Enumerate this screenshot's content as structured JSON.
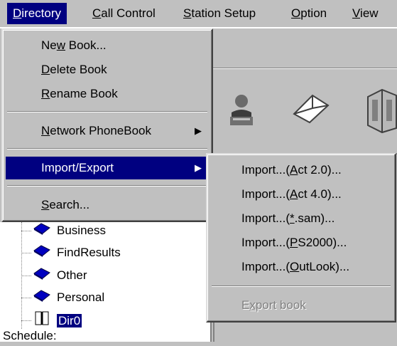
{
  "menubar": {
    "items": [
      {
        "label_pre": "",
        "label_u": "D",
        "label_post": "irectory"
      },
      {
        "label_pre": "",
        "label_u": "C",
        "label_post": "all Control"
      },
      {
        "label_pre": "",
        "label_u": "S",
        "label_post": "tation Setup"
      },
      {
        "label_pre": "",
        "label_u": "O",
        "label_post": "ption"
      },
      {
        "label_pre": "",
        "label_u": "V",
        "label_post": "iew"
      }
    ]
  },
  "directory_menu": {
    "items": [
      {
        "pre": "Ne",
        "u": "w",
        "post": " Book..."
      },
      {
        "pre": "",
        "u": "D",
        "post": "elete Book"
      },
      {
        "pre": "",
        "u": "R",
        "post": "ename Book"
      },
      {
        "pre": "",
        "u": "N",
        "post": "etwork PhoneBook"
      },
      {
        "pre": "Import/Export",
        "u": "",
        "post": ""
      },
      {
        "pre": "",
        "u": "S",
        "post": "earch..."
      }
    ]
  },
  "import_submenu": {
    "items": [
      {
        "pre": "Import...(",
        "u": "A",
        "post": "ct 2.0)..."
      },
      {
        "pre": "Import...(",
        "u": "A",
        "post": "ct 4.0)..."
      },
      {
        "pre": "Import...(",
        "u": "*",
        "post": ".sam)..."
      },
      {
        "pre": "Import...(",
        "u": "P",
        "post": "S2000)..."
      },
      {
        "pre": "Import...(",
        "u": "O",
        "post": "utLook)..."
      },
      {
        "pre": "E",
        "u": "x",
        "post": "port book"
      }
    ]
  },
  "tree": {
    "items": [
      "Business",
      "FindResults",
      "Other",
      "Personal",
      "Dir0"
    ],
    "footer": "Schedule:"
  },
  "colors": {
    "face": "#c0c0c0",
    "highlight": "#000080",
    "book_blue": "#0000c0"
  }
}
